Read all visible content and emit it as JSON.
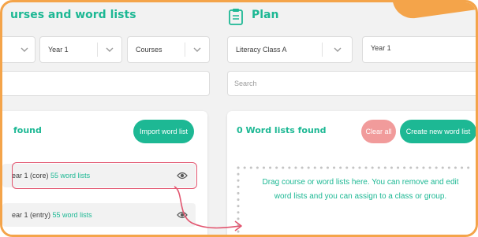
{
  "left": {
    "title": "urses and word lists",
    "filters": [
      "",
      "Year 1",
      "Courses"
    ],
    "found_text": "found",
    "import_button": "Import word list",
    "items": [
      {
        "label": "ear 1 (core)",
        "count": "55 word lists"
      },
      {
        "label": "ear 1 (entry)",
        "count": "55 word lists"
      }
    ]
  },
  "plan": {
    "title": "Plan",
    "class_select": "Literacy Class A",
    "year_select": "Year 1",
    "search_placeholder": "Search",
    "found_text": "0 Word lists found",
    "clear_button": "Clear all",
    "create_button": "Create new word list",
    "drop_hint": "Drag course or word lists here. You can remove and edit word lists and you can assign to a class or group."
  },
  "colors": {
    "accent": "#1db894",
    "frame": "#f4a44a",
    "highlight": "#e2556f",
    "clear_button": "#f19b9b"
  },
  "icons": [
    "clipboard-icon",
    "chevron-down-icon",
    "eye-icon",
    "drag-arrow-icon"
  ]
}
